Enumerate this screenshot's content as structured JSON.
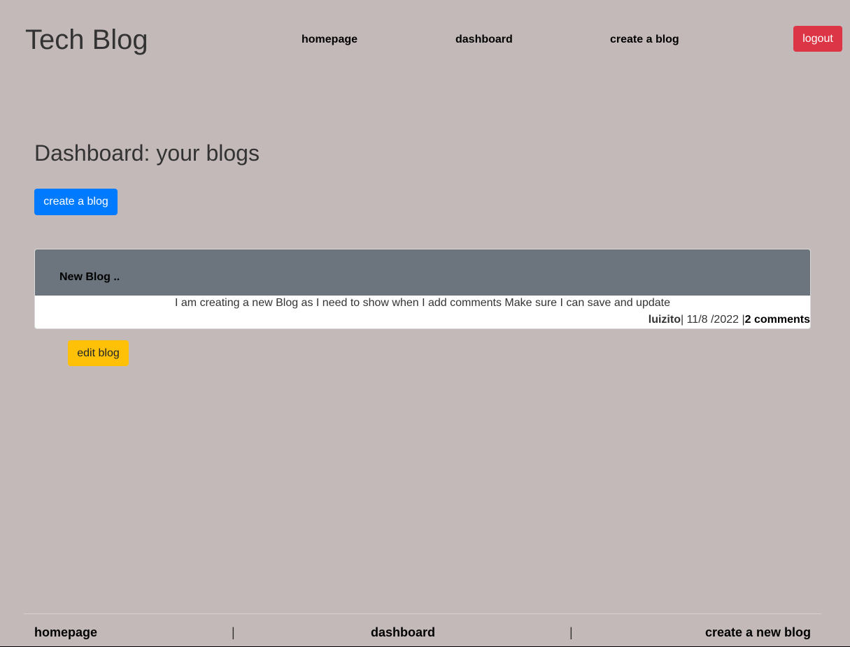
{
  "header": {
    "site_title": "Tech Blog",
    "nav": {
      "homepage": "homepage",
      "dashboard": "dashboard",
      "create_blog": "create a blog"
    },
    "logout_label": "logout"
  },
  "main": {
    "heading": "Dashboard: your blogs",
    "create_button_label": "create a blog",
    "blogs": [
      {
        "title": "New Blog ..",
        "content": "I am creating a new Blog as I need to show when I add comments Make sure I can save and update",
        "author": "luizito",
        "date_text": "| 11/8 /2022 |",
        "comments_label": "2 comments",
        "edit_label": "edit blog"
      }
    ]
  },
  "footer": {
    "homepage": "homepage",
    "separator": "|",
    "dashboard": "dashboard",
    "create_new_blog": "create a new blog"
  },
  "colors": {
    "background": "#c4b9b9",
    "logout": "#dc3545",
    "primary": "#007bff",
    "card_header": "#6c757d",
    "edit": "#ffc107"
  }
}
